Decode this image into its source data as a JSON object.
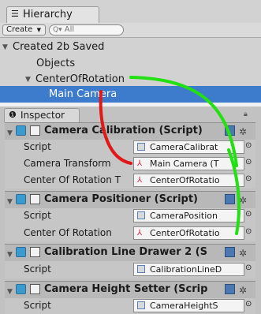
{
  "hierarchy": {
    "tab_label": "Hierarchy",
    "create_label": "Create",
    "search_placeholder": "All",
    "scene_name": "Created 2b Saved",
    "items": [
      "Objects",
      "CenterOfRotation",
      "Main Camera"
    ]
  },
  "inspector": {
    "tab_label": "Inspector",
    "components": [
      {
        "title": "Camera Calibration (Script)",
        "fields": [
          {
            "label": "Script",
            "value": "CameraCalibrat"
          },
          {
            "label": "Camera Transform",
            "value": "Main Camera (T"
          },
          {
            "label": "Center Of Rotation T",
            "value": "CenterOfRotatio"
          }
        ]
      },
      {
        "title": "Camera Positioner (Script)",
        "fields": [
          {
            "label": "Script",
            "value": "CameraPosition"
          },
          {
            "label": "Center Of Rotation",
            "value": "CenterOfRotatio"
          }
        ]
      },
      {
        "title": "Calibration Line Drawer 2 (S",
        "fields": [
          {
            "label": "Script",
            "value": "CalibrationLineD"
          }
        ]
      },
      {
        "title": "Camera Height Setter (Scrip",
        "fields": [
          {
            "label": "Script",
            "value": "CameraHeightS"
          }
        ]
      }
    ]
  },
  "colors": {
    "selection": "#3d7ccd",
    "red_arrow": "#e01818",
    "green_arrow": "#22e011"
  },
  "icons": {
    "menu": "hamburger-icon",
    "gear": "gear-icon",
    "target": "object-picker-icon"
  }
}
